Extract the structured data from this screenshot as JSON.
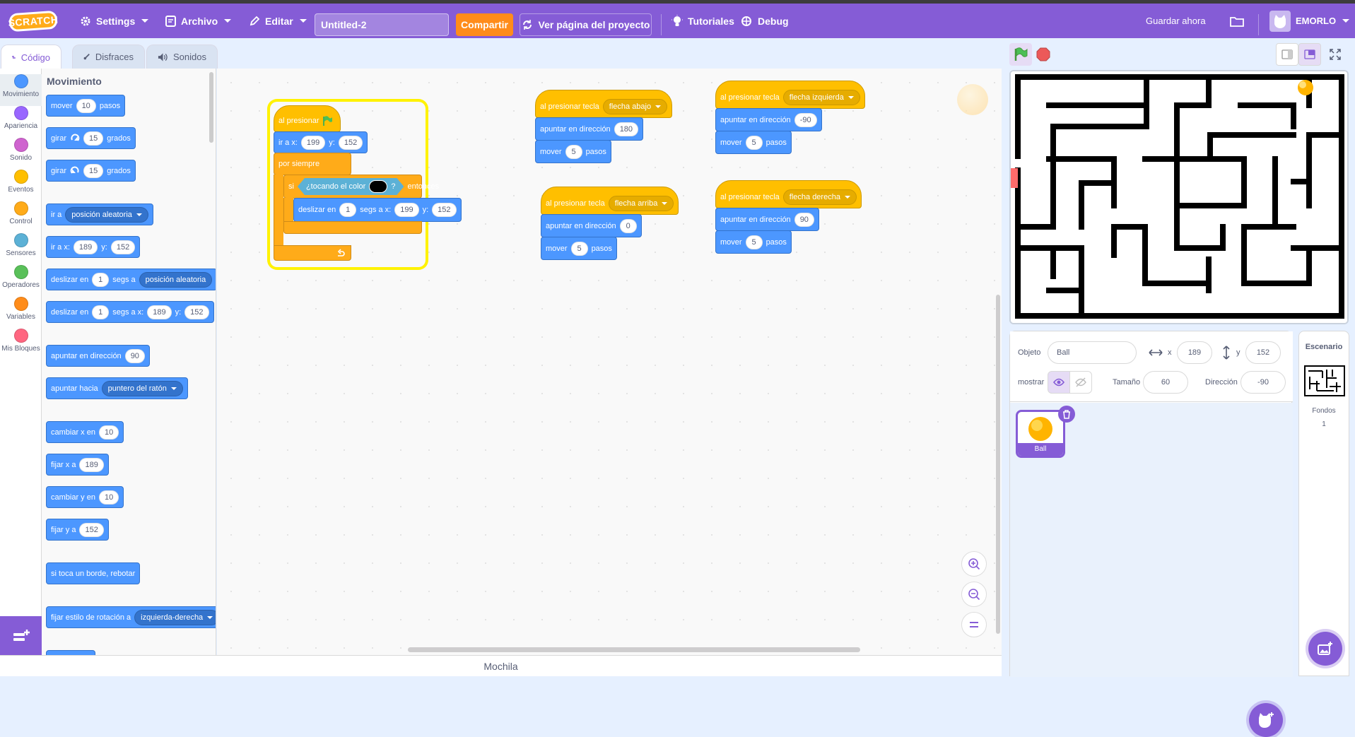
{
  "menubar": {
    "logo": "SCRATCH",
    "settings": "Settings",
    "file": "Archivo",
    "edit": "Editar",
    "project_title": "Untitled-2",
    "share": "Compartir",
    "project_page": "Ver página del proyecto",
    "tutorials": "Tutoriales",
    "debug": "Debug",
    "save_now": "Guardar ahora",
    "username": "EMORLO"
  },
  "tabs": {
    "code": "Código",
    "costumes": "Disfraces",
    "sounds": "Sonidos"
  },
  "categories": [
    {
      "label": "Movimiento",
      "color": "#4c97ff"
    },
    {
      "label": "Apariencia",
      "color": "#9966ff"
    },
    {
      "label": "Sonido",
      "color": "#cf63cf"
    },
    {
      "label": "Eventos",
      "color": "#ffbf00"
    },
    {
      "label": "Control",
      "color": "#ffab19"
    },
    {
      "label": "Sensores",
      "color": "#5cb1d6"
    },
    {
      "label": "Operadores",
      "color": "#59c059"
    },
    {
      "label": "Variables",
      "color": "#ff8c1a"
    },
    {
      "label": "Mis Bloques",
      "color": "#ff6680"
    }
  ],
  "palette": {
    "heading": "Movimiento",
    "move": {
      "a": "mover",
      "v": "10",
      "b": "pasos"
    },
    "turn_right": {
      "a": "girar",
      "v": "15",
      "b": "grados"
    },
    "turn_left": {
      "a": "girar",
      "v": "15",
      "b": "grados"
    },
    "goto": {
      "a": "ir a",
      "dd": "posición aleatoria"
    },
    "goto_xy": {
      "a": "ir a x:",
      "x": "189",
      "b": "y:",
      "y": "152"
    },
    "glide_to": {
      "a": "deslizar en",
      "v": "1",
      "b": "segs a",
      "dd": "posición aleatoria"
    },
    "glide_xy": {
      "a": "deslizar en",
      "v": "1",
      "b": "segs a x:",
      "x": "189",
      "c": "y:",
      "y": "152"
    },
    "point_dir": {
      "a": "apuntar en dirección",
      "v": "90"
    },
    "point_towards": {
      "a": "apuntar hacia",
      "dd": "puntero del ratón"
    },
    "change_x": {
      "a": "cambiar x en",
      "v": "10"
    },
    "set_x": {
      "a": "fijar x a",
      "v": "189"
    },
    "change_y": {
      "a": "cambiar y en",
      "v": "10"
    },
    "set_y": {
      "a": "fijar y a",
      "v": "152"
    },
    "bounce": {
      "a": "si toca un borde, rebotar"
    },
    "rotation_style": {
      "a": "fijar estilo de rotación a",
      "dd": "izquierda-derecha"
    }
  },
  "script_main": {
    "hat": "al presionar",
    "goto_a": "ir a x:",
    "goto_x": "199",
    "goto_b": "y:",
    "goto_y": "152",
    "forever": "por siempre",
    "if": "si",
    "touching": "¿tocando el color",
    "q": "?",
    "then": "entonces",
    "glide_a": "deslizar en",
    "glide_v": "1",
    "glide_b": "segs a x:",
    "glide_x": "199",
    "glide_c": "y:",
    "glide_y": "152"
  },
  "script_down": {
    "hat": "al presionar tecla",
    "key": "flecha abajo",
    "point": "apuntar en dirección",
    "dir": "180",
    "move": "mover",
    "steps": "5",
    "pasos": "pasos"
  },
  "script_up": {
    "hat": "al presionar tecla",
    "key": "flecha arriba",
    "point": "apuntar en dirección",
    "dir": "0",
    "move": "mover",
    "steps": "5",
    "pasos": "pasos"
  },
  "script_left": {
    "hat": "al presionar tecla",
    "key": "flecha izquierda",
    "point": "apuntar en dirección",
    "dir": "-90",
    "move": "mover",
    "steps": "5",
    "pasos": "pasos"
  },
  "script_right": {
    "hat": "al presionar tecla",
    "key": "flecha derecha",
    "point": "apuntar en dirección",
    "dir": "90",
    "move": "mover",
    "steps": "5",
    "pasos": "pasos"
  },
  "backpack": "Mochila",
  "sprite_info": {
    "sprite_label": "Objeto",
    "sprite_name": "Ball",
    "x_label": "x",
    "x": "189",
    "y_label": "y",
    "y": "152",
    "show_label": "mostrar",
    "size_label": "Tamaño",
    "size": "60",
    "direction_label": "Dirección",
    "direction": "-90"
  },
  "sprites": [
    {
      "name": "Ball"
    }
  ],
  "stage_pane": {
    "title": "Escenario",
    "backdrops_label": "Fondos",
    "backdrops_count": "1"
  },
  "colors": {
    "accent": "#855cd6",
    "motion": "#4c97ff",
    "events": "#ffbf00",
    "control": "#ffab19",
    "sensing": "#5cb1d6",
    "share": "#ff8c1a"
  }
}
